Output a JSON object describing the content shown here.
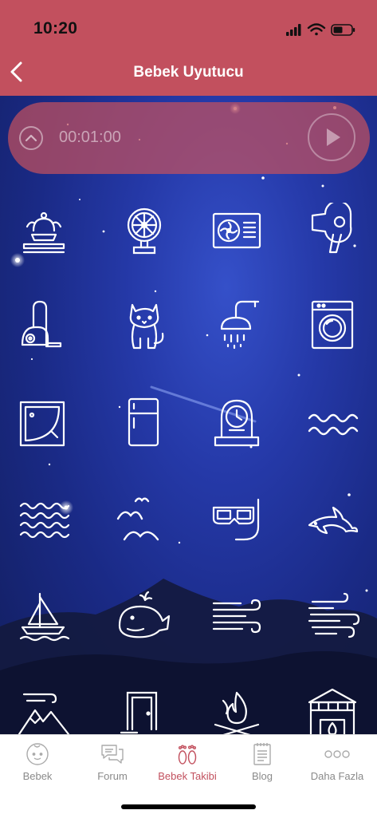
{
  "status": {
    "time": "10:20"
  },
  "nav": {
    "title": "Bebek Uyutucu"
  },
  "player": {
    "timer": "00:01:00"
  },
  "sounds": [
    {
      "icon": "fountain-icon"
    },
    {
      "icon": "fan-icon"
    },
    {
      "icon": "air-conditioner-icon"
    },
    {
      "icon": "hair-dryer-icon"
    },
    {
      "icon": "vacuum-cleaner-icon"
    },
    {
      "icon": "cat-icon"
    },
    {
      "icon": "shower-icon"
    },
    {
      "icon": "washing-machine-icon"
    },
    {
      "icon": "bathtub-icon"
    },
    {
      "icon": "refrigerator-icon"
    },
    {
      "icon": "clock-icon"
    },
    {
      "icon": "waves-icon"
    },
    {
      "icon": "sea-icon"
    },
    {
      "icon": "seagulls-icon"
    },
    {
      "icon": "snorkel-mask-icon"
    },
    {
      "icon": "dolphin-icon"
    },
    {
      "icon": "sailboat-icon"
    },
    {
      "icon": "whale-icon"
    },
    {
      "icon": "wind-icon"
    },
    {
      "icon": "strong-wind-icon"
    },
    {
      "icon": "mountain-wind-icon"
    },
    {
      "icon": "door-icon"
    },
    {
      "icon": "campfire-icon"
    },
    {
      "icon": "fireplace-icon"
    }
  ],
  "tabs": [
    {
      "label": "Bebek",
      "icon": "baby-face-icon"
    },
    {
      "label": "Forum",
      "icon": "chat-bubbles-icon"
    },
    {
      "label": "Bebek Takibi",
      "icon": "footprints-icon"
    },
    {
      "label": "Blog",
      "icon": "notepad-icon"
    },
    {
      "label": "Daha Fazla",
      "icon": "more-dots-icon"
    }
  ],
  "colors": {
    "accent": "#c2505e",
    "sky": "#2539a8",
    "tab_inactive": "#8a8a8a"
  }
}
